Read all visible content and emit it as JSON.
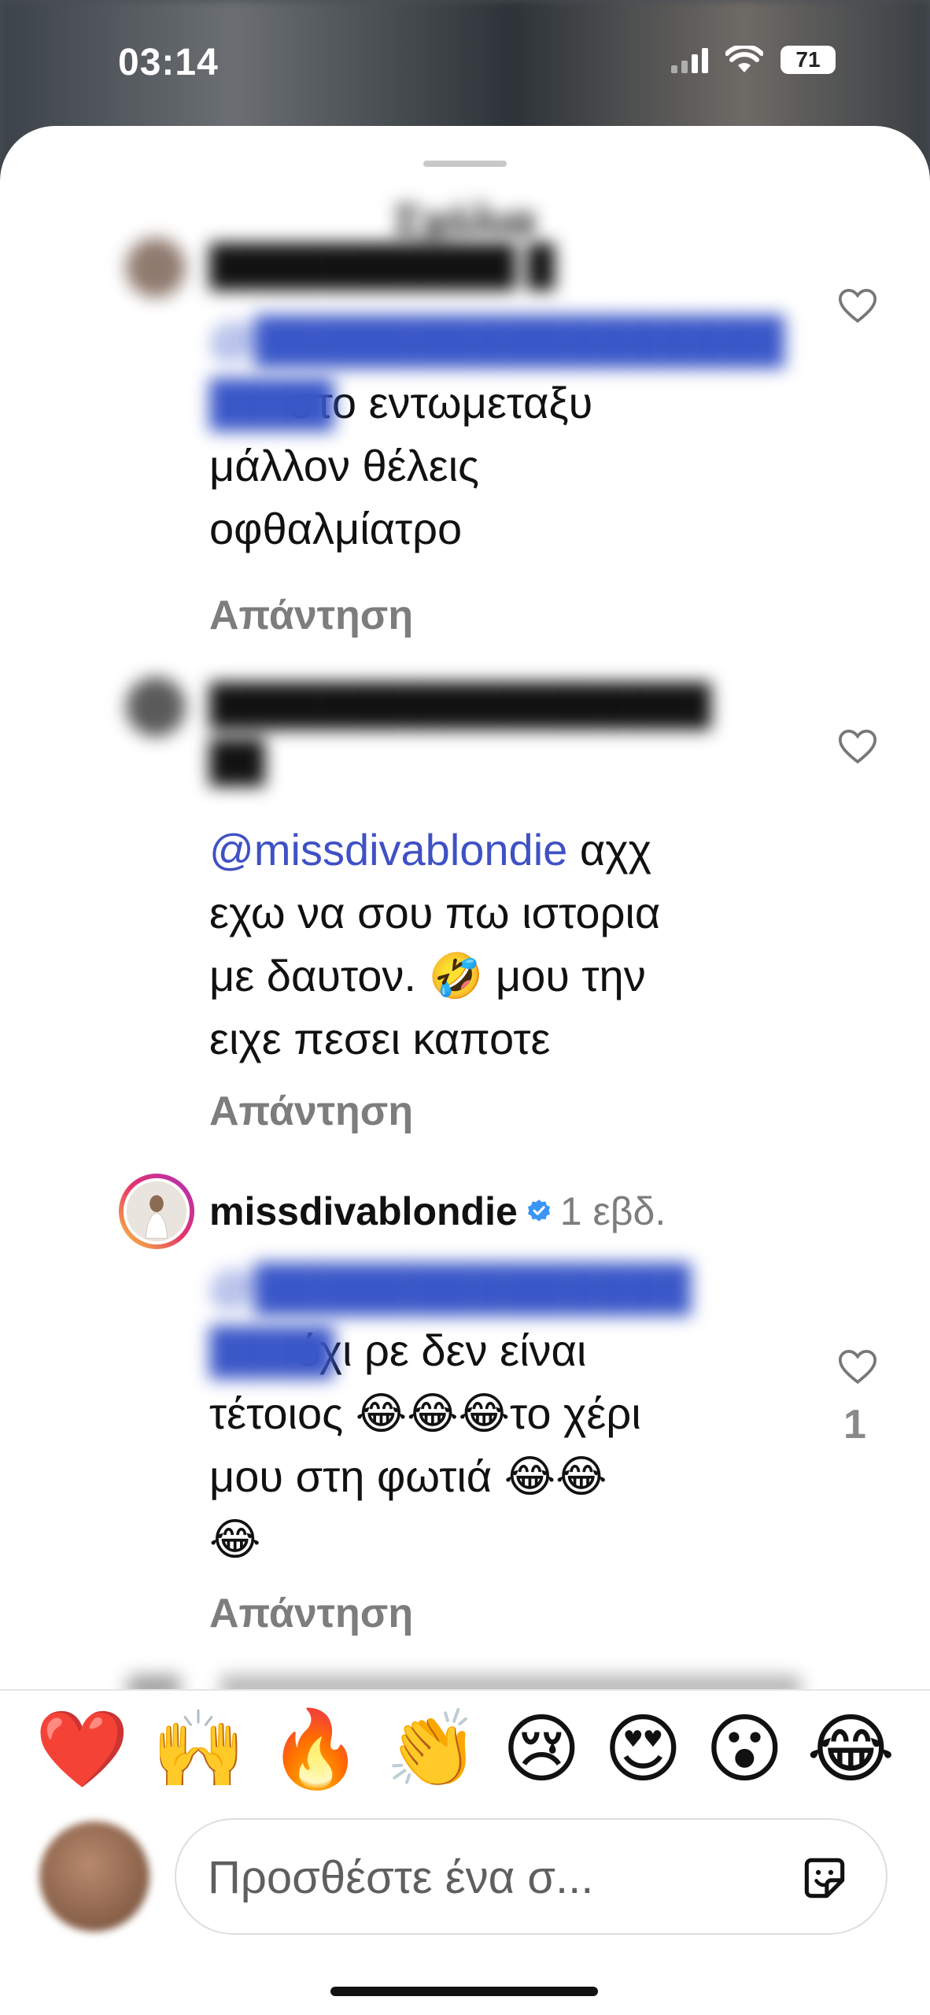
{
  "status_bar": {
    "time": "03:14",
    "battery": "71"
  },
  "sheet": {
    "title": "Σχόλια"
  },
  "comments": [
    {
      "username": "███████████",
      "time": "█",
      "mention": "@█████████████████",
      "text_line1": "στο εντωμεταξυ",
      "text_line2": "μάλλον θέλεις",
      "text_line3": "οφθαλμίατρο",
      "reply_label": "Απάντηση"
    },
    {
      "username": "██████████████████",
      "time": "██",
      "mention": "@missdivablondie",
      "text_line1": " αχχ",
      "text_line2": "εχω να σου πω ιστορια",
      "text_line3": "με δαυτον. 🤣 μου την",
      "text_line4": "ειχε πεσει καποτε",
      "reply_label": "Απάντηση"
    },
    {
      "username": "missdivablondie",
      "time": "1 εβδ.",
      "mention": "@██████████████",
      "text_line1": "όχι ρε δεν είναι",
      "text_line2": "τέτοιος 😂😂😂το χέρι",
      "text_line3": "μου στη φωτιά 😂😂",
      "text_line4": "😂",
      "reply_label": "Απάντηση",
      "likes": "1"
    }
  ],
  "emoji_bar": [
    "❤️",
    "🙌",
    "🔥",
    "👏",
    "😢",
    "😍",
    "😮",
    "😂"
  ],
  "input": {
    "placeholder": "Προσθέστε ένα σ..."
  }
}
